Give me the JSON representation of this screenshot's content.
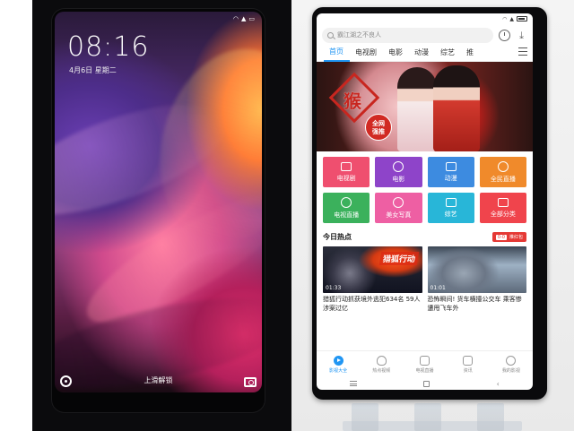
{
  "left_phone": {
    "time": "08:16",
    "date": "4月6日  星期二",
    "unlock_hint": "上滑解锁"
  },
  "right_phone": {
    "search_placeholder": "霸江湖之不良人",
    "tabs": [
      "首页",
      "电视剧",
      "电影",
      "动漫",
      "综艺",
      "推"
    ],
    "active_tab": "首页",
    "banner": {
      "seal_text": "猴",
      "badge": "全网\n强推"
    },
    "categories": [
      {
        "label": "电视剧",
        "color": "#ef4f6f",
        "icon": "tv-icon"
      },
      {
        "label": "电影",
        "color": "#8e44c9",
        "icon": "film-icon"
      },
      {
        "label": "动漫",
        "color": "#3d8be0",
        "icon": "anime-icon"
      },
      {
        "label": "全民直播",
        "color": "#f08a2b",
        "icon": "live-people-icon"
      },
      {
        "label": "电视直播",
        "color": "#3bb15c",
        "icon": "tv-live-icon"
      },
      {
        "label": "美女写真",
        "color": "#ee5fa3",
        "icon": "camera-icon"
      },
      {
        "label": "综艺",
        "color": "#28b6d8",
        "icon": "variety-icon"
      },
      {
        "label": "全部分类",
        "color": "#f0444c",
        "icon": "grid-icon"
      }
    ],
    "hot_section": {
      "title": "今日热点",
      "badge_pill": "0-0",
      "badge_text": "推红包"
    },
    "videos": [
      {
        "banner": "猎狐行动",
        "duration": "01:33",
        "title": "猎狐行动抓获境外逃犯634名 59人涉案过亿"
      },
      {
        "banner": "",
        "duration": "01:01",
        "title": "恐怖瞬间! 货车横撞公交车 乘客惨遭甩飞车外"
      }
    ],
    "bottom_nav": [
      {
        "label": "影视大全",
        "active": true
      },
      {
        "label": "热点视频",
        "active": false
      },
      {
        "label": "电视直播",
        "active": false
      },
      {
        "label": "资讯",
        "active": false
      },
      {
        "label": "我的影视",
        "active": false
      }
    ],
    "colors": {
      "accent": "#2196f3",
      "hot_badge": "#e53935"
    }
  }
}
